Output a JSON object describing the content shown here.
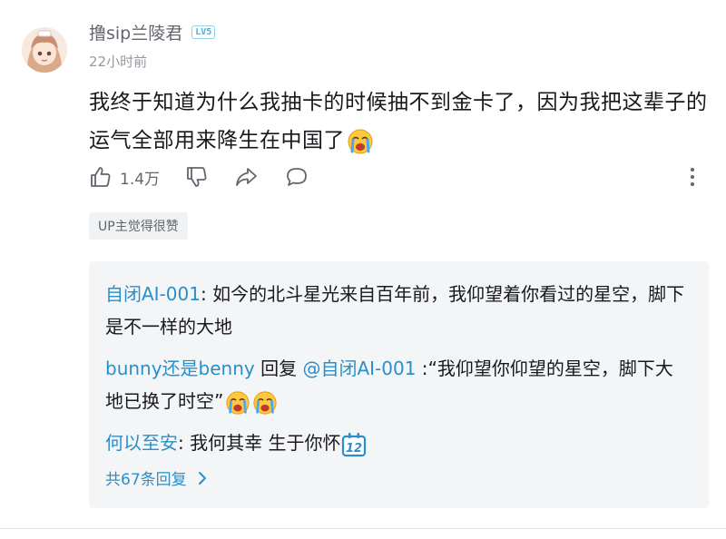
{
  "comment": {
    "username": "撸sip兰陵君",
    "level": "LV5",
    "time": "22小时前",
    "text": "我终于知道为什么我抽卡的时候抽不到金卡了，因为我把这辈子的运气全部用来降生在中国了",
    "emoji": "crying-face",
    "like_count": "1.4万",
    "up_liked_label": "UP主觉得很赞"
  },
  "replies": [
    {
      "user": "自闭AI-001",
      "separator": ": ",
      "text": "如今的北斗星光来自百年前，我仰望着你看过的星空，脚下是不一样的大地"
    },
    {
      "user": "bunny还是benny",
      "reply_word": " 回复 ",
      "target": "@自闭AI-001",
      "separator": " :",
      "text": "“我仰望你仰望的星空，脚下大地已换了时空”",
      "emojis": [
        "crying-face",
        "crying-face"
      ]
    },
    {
      "user": "何以至安",
      "separator": ": ",
      "text": "我何其幸 生于你怀",
      "emoji": "number-12-badge"
    }
  ],
  "more_replies_label": "共67条回复",
  "colors": {
    "link": "#2a8fc9",
    "text": "#18191c",
    "muted": "#61666d",
    "reply_bg": "#f4f5f7"
  }
}
